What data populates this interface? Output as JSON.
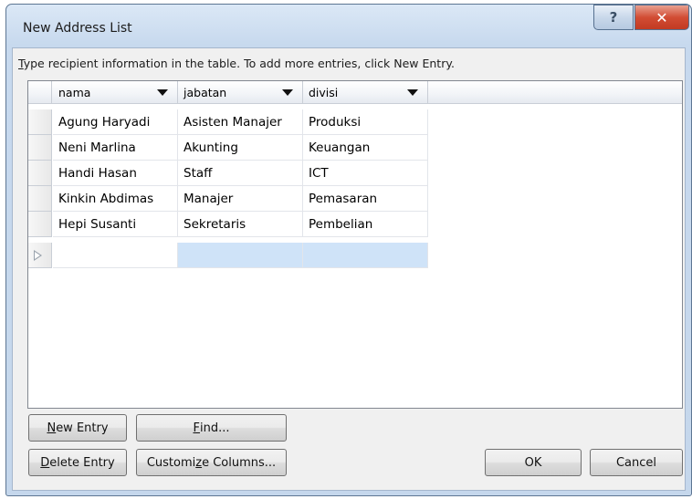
{
  "window": {
    "title": "New Address List",
    "help_glyph": "?",
    "close_glyph": "✕"
  },
  "instruction": {
    "prefix_accel": "T",
    "text": "ype recipient information in the table.  To add more entries, click New Entry."
  },
  "columns": [
    {
      "label": "nama"
    },
    {
      "label": "jabatan"
    },
    {
      "label": "divisi"
    }
  ],
  "rows": [
    [
      "Agung Haryadi",
      "Asisten Manajer",
      "Produksi"
    ],
    [
      "Neni Marlina",
      "Akunting",
      "Keuangan"
    ],
    [
      "Handi Hasan",
      "Staff",
      "ICT"
    ],
    [
      "Kinkin Abdimas",
      "Manajer",
      "Pemasaran"
    ],
    [
      "Hepi Susanti",
      "Sekretaris",
      "Pembelian"
    ]
  ],
  "buttons": {
    "new_entry": {
      "accel": "N",
      "rest": "ew Entry"
    },
    "find": {
      "accel": "F",
      "rest": "ind..."
    },
    "delete_entry": {
      "accel": "D",
      "rest": "elete Entry"
    },
    "customize": {
      "pre": "Customi",
      "accel": "z",
      "rest": "e Columns..."
    },
    "ok": "OK",
    "cancel": "Cancel"
  }
}
